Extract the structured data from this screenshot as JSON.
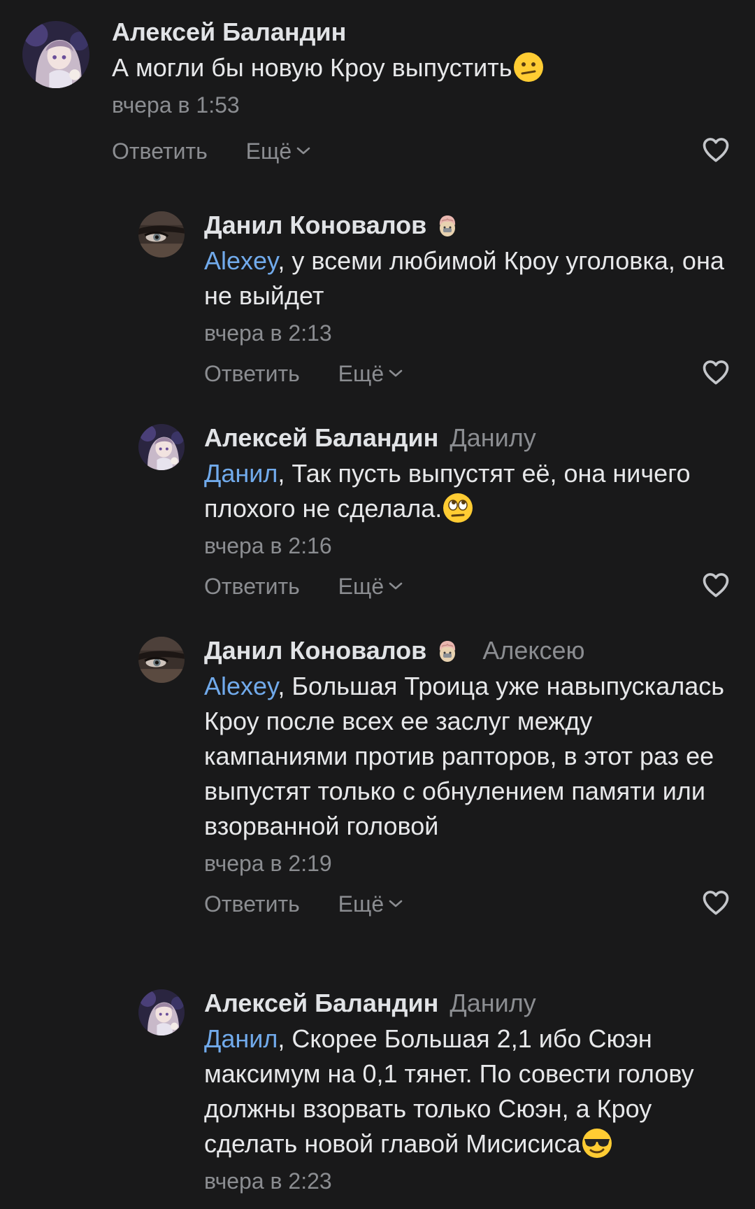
{
  "comments": [
    {
      "author": "Алексей Баландин",
      "reply_to": "",
      "mention": "",
      "text": "А могли бы новую Кроу выпустить",
      "emoji": "confused-face",
      "time": "вчера в 1:53",
      "reply_label": "Ответить",
      "more_label": "Ещё"
    },
    {
      "author": "Данил Коновалов",
      "badge": "brain-emoji",
      "reply_to": "",
      "mention": "Alexey",
      "text": ", у всеми любимой Кроу уголовка, она не выйдет",
      "time": "вчера в 2:13",
      "reply_label": "Ответить",
      "more_label": "Ещё"
    },
    {
      "author": "Алексей Баландин",
      "reply_to": "Данилу",
      "mention": "Данил",
      "text": ", Так пусть выпустят её, она ничего плохого не сделала.",
      "emoji": "eye-roll-face",
      "time": "вчера в 2:16",
      "reply_label": "Ответить",
      "more_label": "Ещё"
    },
    {
      "author": "Данил Коновалов",
      "badge": "brain-emoji",
      "reply_to": "Алексею",
      "mention": "Alexey",
      "text": ", Большая Троица уже навыпускалась Кроу после всех ее заслуг между кампаниями против рапторов, в этот раз ее выпустят только с обнулением памяти или взорванной головой",
      "time": "вчера в 2:19",
      "reply_label": "Ответить",
      "more_label": "Ещё"
    },
    {
      "author": "Алексей Баландин",
      "reply_to": "Данилу",
      "mention": "Данил",
      "text": ", Скорее Большая 2,1 ибо Сюэн максимум на 0,1 тянет. По совести голову должны взорвать только Сюэн, а Кроу сделать новой главой Мисисиса",
      "emoji": "sunglasses-face",
      "time": "вчера в 2:23",
      "reply_label": "Ответить",
      "more_label": "Ещё"
    }
  ],
  "colors": {
    "background": "#19191a",
    "text": "#e1e3e6",
    "secondary": "#8b8d91",
    "link": "#71aaeb"
  }
}
